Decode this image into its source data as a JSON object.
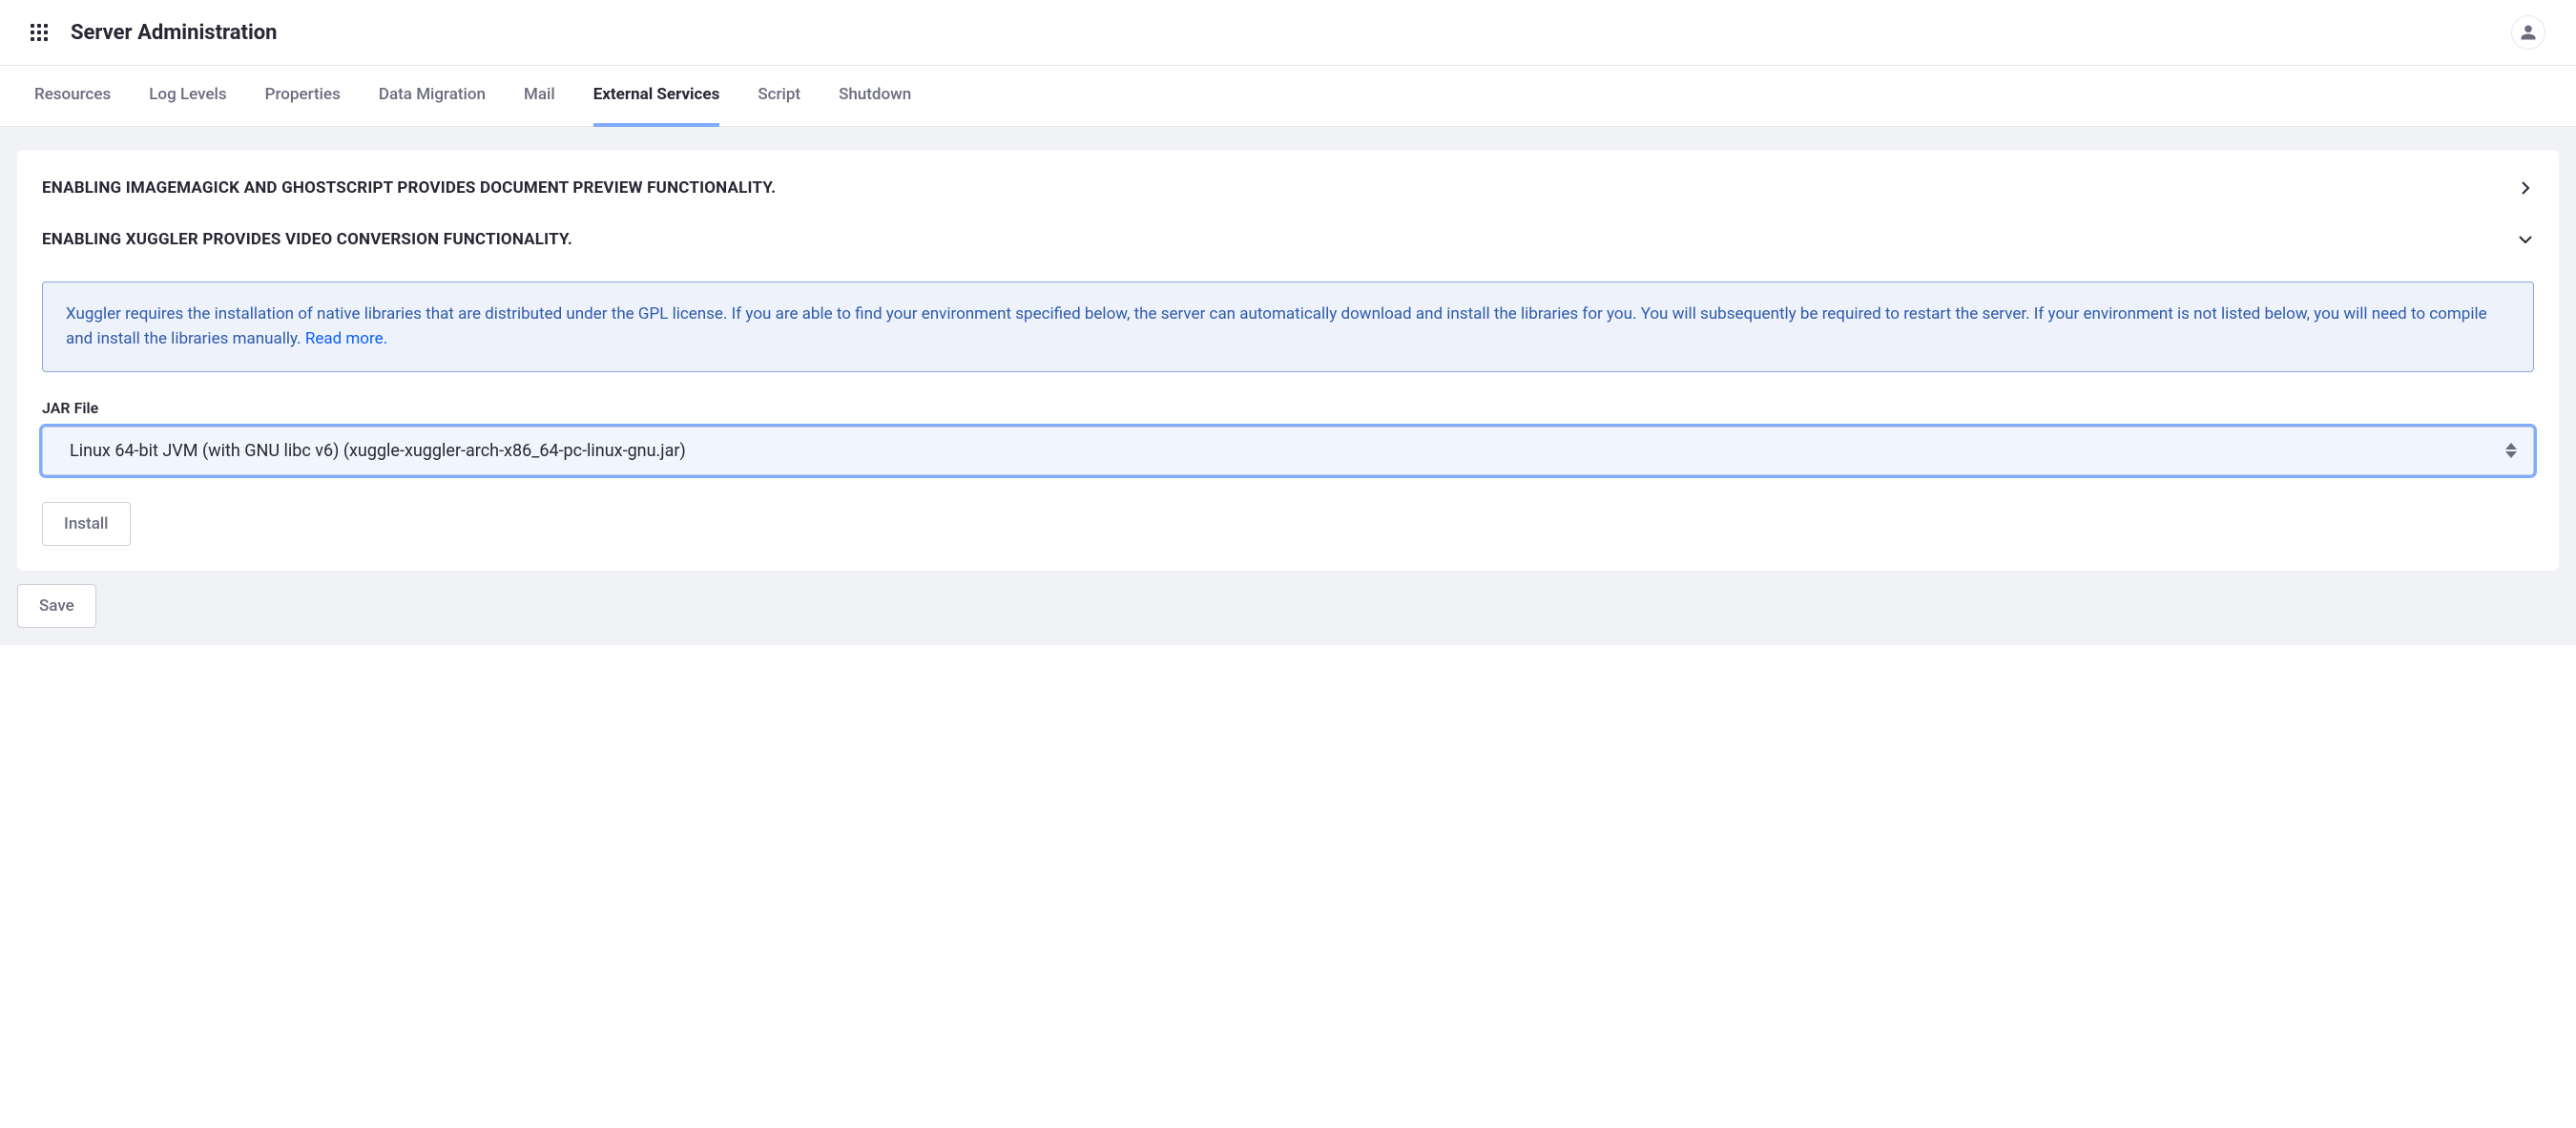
{
  "header": {
    "title": "Server Administration"
  },
  "tabs": [
    {
      "label": "Resources",
      "active": false
    },
    {
      "label": "Log Levels",
      "active": false
    },
    {
      "label": "Properties",
      "active": false
    },
    {
      "label": "Data Migration",
      "active": false
    },
    {
      "label": "Mail",
      "active": false
    },
    {
      "label": "External Services",
      "active": true
    },
    {
      "label": "Script",
      "active": false
    },
    {
      "label": "Shutdown",
      "active": false
    }
  ],
  "sections": {
    "imagemagick": {
      "title": "ENABLING IMAGEMAGICK AND GHOSTSCRIPT PROVIDES DOCUMENT PREVIEW FUNCTIONALITY.",
      "expanded": false
    },
    "xuggler": {
      "title": "ENABLING XUGGLER PROVIDES VIDEO CONVERSION FUNCTIONALITY.",
      "expanded": true,
      "info_text": "Xuggler requires the installation of native libraries that are distributed under the GPL license. If you are able to find your environment specified below, the server can automatically download and install the libraries for you. You will subsequently be required to restart the server. If your environment is not listed below, you will need to compile and install the libraries manually. ",
      "info_link_text": "Read more.",
      "jar_label": "JAR File",
      "jar_selected": "Linux 64-bit JVM (with GNU libc v6) (xuggle-xuggler-arch-x86_64-pc-linux-gnu.jar)",
      "install_label": "Install"
    }
  },
  "buttons": {
    "save": "Save"
  }
}
